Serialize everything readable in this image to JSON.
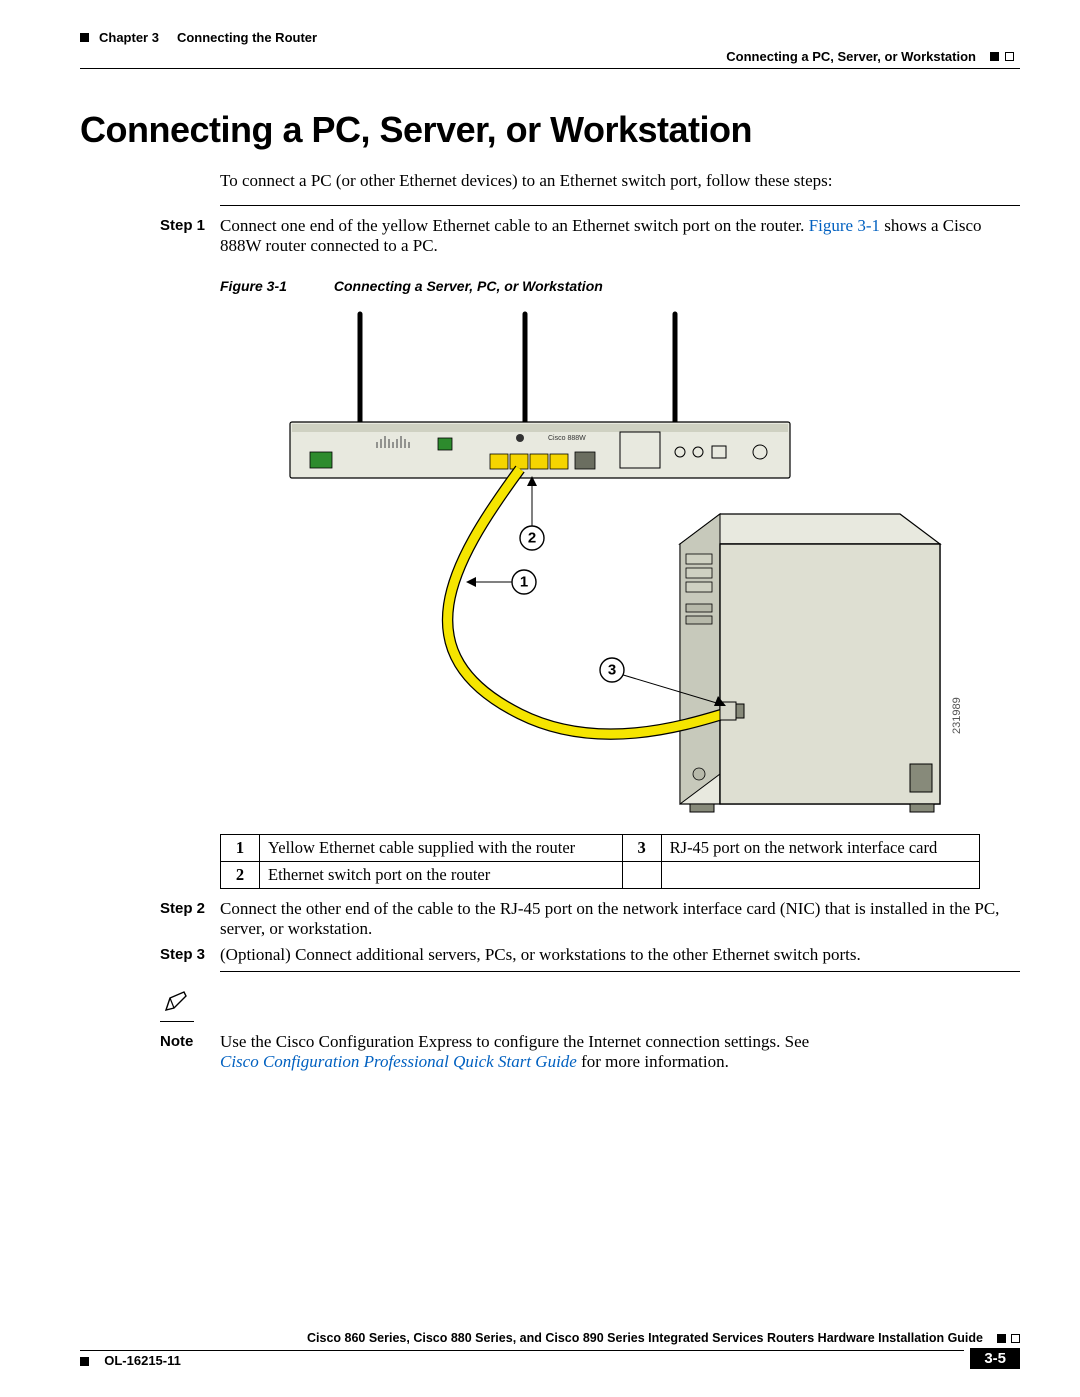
{
  "header": {
    "chapter_label": "Chapter 3",
    "chapter_title": "Connecting the Router",
    "section_title": "Connecting a PC, Server, or Workstation"
  },
  "title": "Connecting a PC, Server, or Workstation",
  "intro": "To connect a PC (or other Ethernet devices) to an Ethernet switch port, follow these steps:",
  "steps": [
    {
      "label": "Step 1",
      "text_before_ref": "Connect one end of the yellow Ethernet cable to an Ethernet switch port on the router. ",
      "ref": "Figure 3-1",
      "text_after_ref": " shows a Cisco 888W router connected to a PC."
    },
    {
      "label": "Step 2",
      "text": "Connect the other end of the cable to the RJ-45 port on the network interface card (NIC) that is installed in the PC, server, or workstation."
    },
    {
      "label": "Step 3",
      "text": "(Optional) Connect additional servers, PCs, or workstations to the other Ethernet switch ports."
    }
  ],
  "figure": {
    "number": "Figure 3-1",
    "caption": "Connecting a Server, PC, or Workstation",
    "router_label": "Cisco 888W",
    "image_id": "231989",
    "callouts": {
      "c1": "1",
      "c2": "2",
      "c3": "3"
    }
  },
  "legend": [
    {
      "num": "1",
      "text": "Yellow Ethernet cable supplied with the router"
    },
    {
      "num": "3",
      "text": "RJ-45 port on the network interface card"
    },
    {
      "num": "2",
      "text": "Ethernet switch port on the router"
    }
  ],
  "note": {
    "label": "Note",
    "text_before_link": "Use the Cisco Configuration Express to configure the Internet connection settings. See ",
    "link": "Cisco Configuration Professional Quick Start Guide",
    "text_after_link": " for more information."
  },
  "footer": {
    "doc_title": "Cisco 860 Series, Cisco 880 Series, and Cisco 890 Series Integrated Services Routers Hardware Installation Guide",
    "doc_number": "OL-16215-11",
    "page_number": "3-5"
  }
}
